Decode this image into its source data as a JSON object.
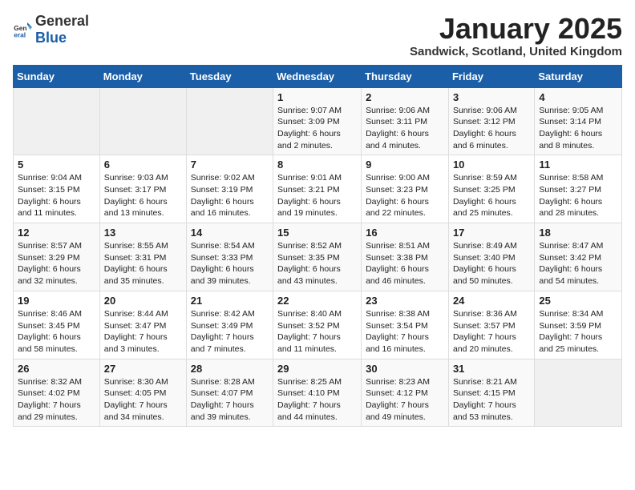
{
  "logo": {
    "general": "General",
    "blue": "Blue"
  },
  "header": {
    "month": "January 2025",
    "location": "Sandwick, Scotland, United Kingdom"
  },
  "weekdays": [
    "Sunday",
    "Monday",
    "Tuesday",
    "Wednesday",
    "Thursday",
    "Friday",
    "Saturday"
  ],
  "weeks": [
    [
      {
        "day": "",
        "content": ""
      },
      {
        "day": "",
        "content": ""
      },
      {
        "day": "",
        "content": ""
      },
      {
        "day": "1",
        "content": "Sunrise: 9:07 AM\nSunset: 3:09 PM\nDaylight: 6 hours and 2 minutes."
      },
      {
        "day": "2",
        "content": "Sunrise: 9:06 AM\nSunset: 3:11 PM\nDaylight: 6 hours and 4 minutes."
      },
      {
        "day": "3",
        "content": "Sunrise: 9:06 AM\nSunset: 3:12 PM\nDaylight: 6 hours and 6 minutes."
      },
      {
        "day": "4",
        "content": "Sunrise: 9:05 AM\nSunset: 3:14 PM\nDaylight: 6 hours and 8 minutes."
      }
    ],
    [
      {
        "day": "5",
        "content": "Sunrise: 9:04 AM\nSunset: 3:15 PM\nDaylight: 6 hours and 11 minutes."
      },
      {
        "day": "6",
        "content": "Sunrise: 9:03 AM\nSunset: 3:17 PM\nDaylight: 6 hours and 13 minutes."
      },
      {
        "day": "7",
        "content": "Sunrise: 9:02 AM\nSunset: 3:19 PM\nDaylight: 6 hours and 16 minutes."
      },
      {
        "day": "8",
        "content": "Sunrise: 9:01 AM\nSunset: 3:21 PM\nDaylight: 6 hours and 19 minutes."
      },
      {
        "day": "9",
        "content": "Sunrise: 9:00 AM\nSunset: 3:23 PM\nDaylight: 6 hours and 22 minutes."
      },
      {
        "day": "10",
        "content": "Sunrise: 8:59 AM\nSunset: 3:25 PM\nDaylight: 6 hours and 25 minutes."
      },
      {
        "day": "11",
        "content": "Sunrise: 8:58 AM\nSunset: 3:27 PM\nDaylight: 6 hours and 28 minutes."
      }
    ],
    [
      {
        "day": "12",
        "content": "Sunrise: 8:57 AM\nSunset: 3:29 PM\nDaylight: 6 hours and 32 minutes."
      },
      {
        "day": "13",
        "content": "Sunrise: 8:55 AM\nSunset: 3:31 PM\nDaylight: 6 hours and 35 minutes."
      },
      {
        "day": "14",
        "content": "Sunrise: 8:54 AM\nSunset: 3:33 PM\nDaylight: 6 hours and 39 minutes."
      },
      {
        "day": "15",
        "content": "Sunrise: 8:52 AM\nSunset: 3:35 PM\nDaylight: 6 hours and 43 minutes."
      },
      {
        "day": "16",
        "content": "Sunrise: 8:51 AM\nSunset: 3:38 PM\nDaylight: 6 hours and 46 minutes."
      },
      {
        "day": "17",
        "content": "Sunrise: 8:49 AM\nSunset: 3:40 PM\nDaylight: 6 hours and 50 minutes."
      },
      {
        "day": "18",
        "content": "Sunrise: 8:47 AM\nSunset: 3:42 PM\nDaylight: 6 hours and 54 minutes."
      }
    ],
    [
      {
        "day": "19",
        "content": "Sunrise: 8:46 AM\nSunset: 3:45 PM\nDaylight: 6 hours and 58 minutes."
      },
      {
        "day": "20",
        "content": "Sunrise: 8:44 AM\nSunset: 3:47 PM\nDaylight: 7 hours and 3 minutes."
      },
      {
        "day": "21",
        "content": "Sunrise: 8:42 AM\nSunset: 3:49 PM\nDaylight: 7 hours and 7 minutes."
      },
      {
        "day": "22",
        "content": "Sunrise: 8:40 AM\nSunset: 3:52 PM\nDaylight: 7 hours and 11 minutes."
      },
      {
        "day": "23",
        "content": "Sunrise: 8:38 AM\nSunset: 3:54 PM\nDaylight: 7 hours and 16 minutes."
      },
      {
        "day": "24",
        "content": "Sunrise: 8:36 AM\nSunset: 3:57 PM\nDaylight: 7 hours and 20 minutes."
      },
      {
        "day": "25",
        "content": "Sunrise: 8:34 AM\nSunset: 3:59 PM\nDaylight: 7 hours and 25 minutes."
      }
    ],
    [
      {
        "day": "26",
        "content": "Sunrise: 8:32 AM\nSunset: 4:02 PM\nDaylight: 7 hours and 29 minutes."
      },
      {
        "day": "27",
        "content": "Sunrise: 8:30 AM\nSunset: 4:05 PM\nDaylight: 7 hours and 34 minutes."
      },
      {
        "day": "28",
        "content": "Sunrise: 8:28 AM\nSunset: 4:07 PM\nDaylight: 7 hours and 39 minutes."
      },
      {
        "day": "29",
        "content": "Sunrise: 8:25 AM\nSunset: 4:10 PM\nDaylight: 7 hours and 44 minutes."
      },
      {
        "day": "30",
        "content": "Sunrise: 8:23 AM\nSunset: 4:12 PM\nDaylight: 7 hours and 49 minutes."
      },
      {
        "day": "31",
        "content": "Sunrise: 8:21 AM\nSunset: 4:15 PM\nDaylight: 7 hours and 53 minutes."
      },
      {
        "day": "",
        "content": ""
      }
    ]
  ]
}
